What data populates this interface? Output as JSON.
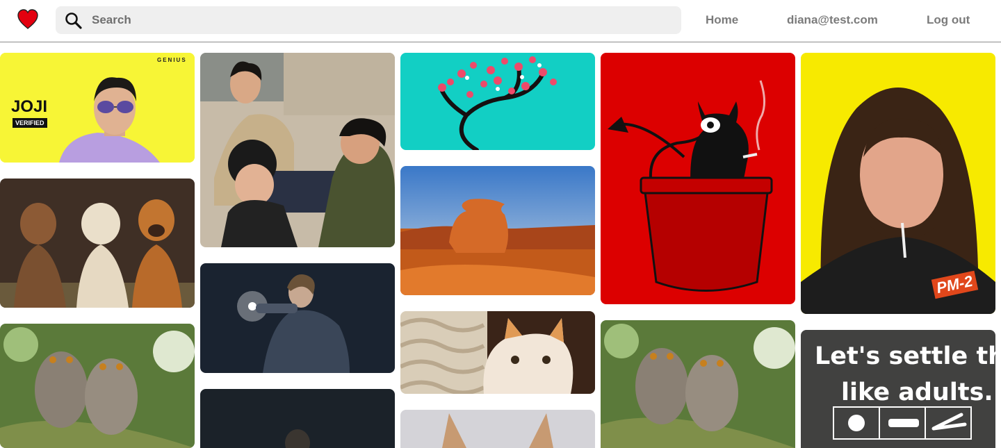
{
  "header": {
    "search_placeholder": "Search",
    "nav": {
      "home": "Home",
      "user": "diana@test.com",
      "logout": "Log out"
    }
  },
  "pins": {
    "joji": {
      "title": "JOJI",
      "badge": "VERIFIED",
      "brand": "GENIUS",
      "bg": "#f7f536"
    },
    "pm2_text": "PM-2",
    "settle": {
      "line1": "Let's settle this",
      "line2": "like adults."
    }
  },
  "colors": {
    "accent_red": "#e3000f",
    "search_bg": "#efefef",
    "nav_text": "#7b7b7b"
  }
}
